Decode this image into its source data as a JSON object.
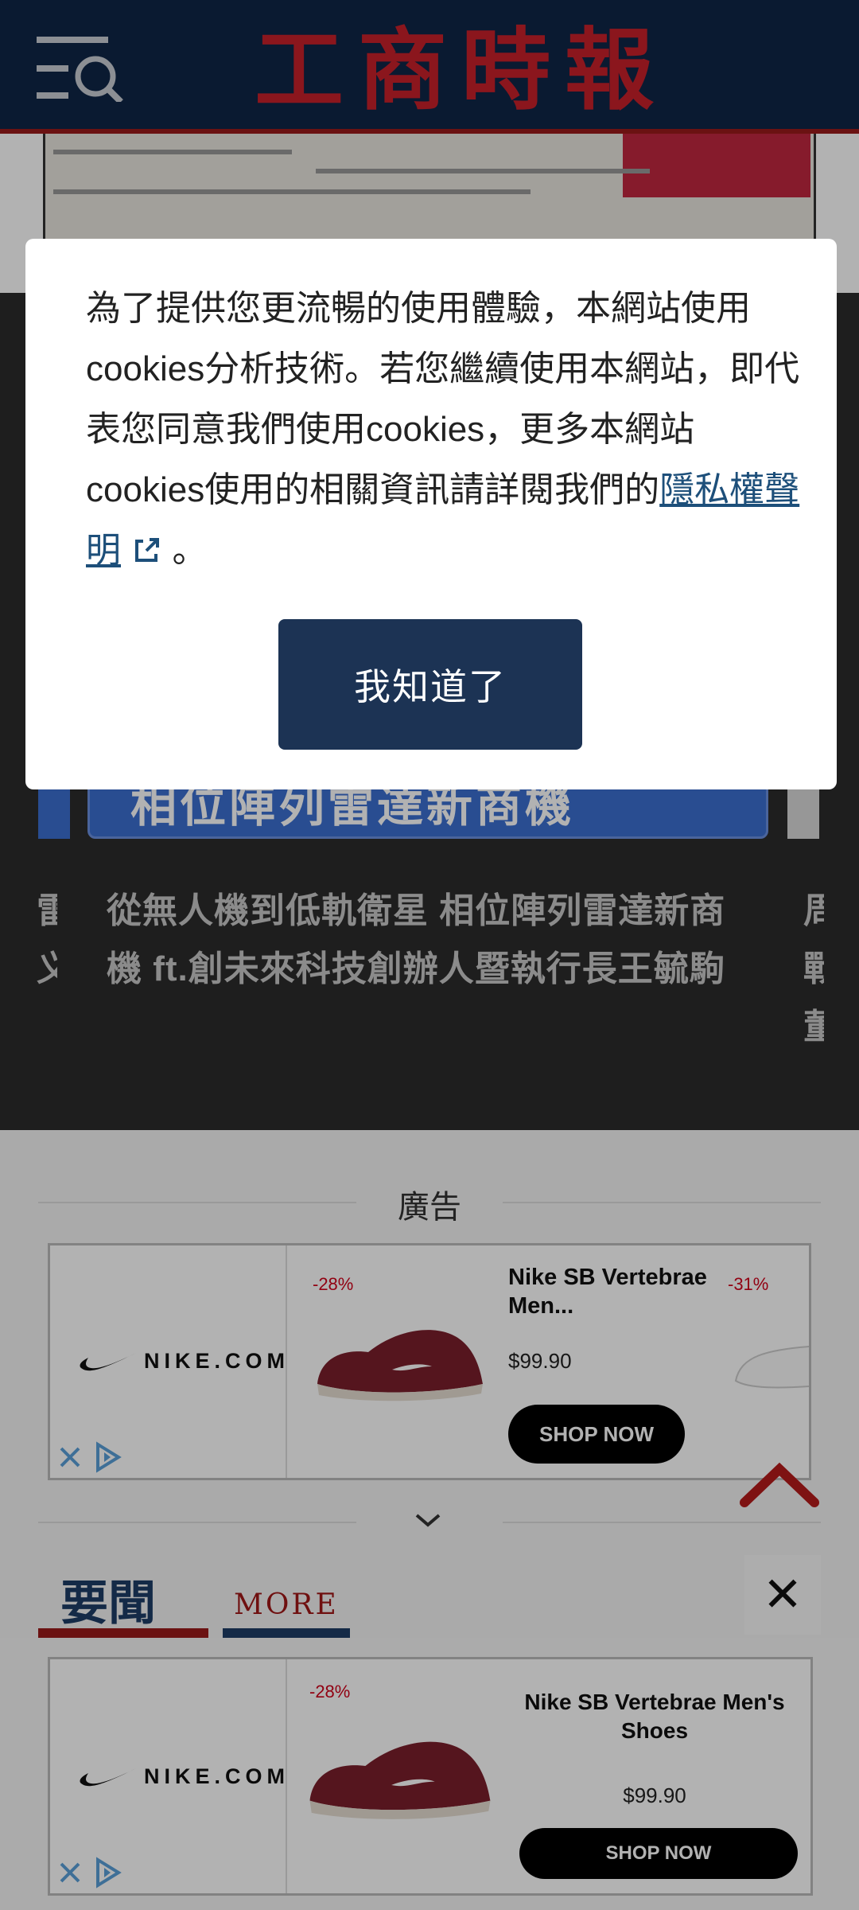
{
  "header": {
    "logo_text": "工商時報",
    "colors": {
      "bar": "#0f2647",
      "logo": "#c8202a",
      "accent_line": "#9a1a1a"
    }
  },
  "featured": {
    "thumbnail_text": "相位陣列雷達新商機",
    "title": "從無人機到低軌衛星 相位陣列雷達新商機 ft.創未來科技創辦人暨執行長王毓駒",
    "left_fragment": "雷\n义",
    "right_fragment": "周\n戰\n董"
  },
  "ad_inline": {
    "label": "廣告",
    "brand": "NIKE.COM",
    "product_discount": "-28%",
    "product_name": "Nike SB Vertebrae Men...",
    "product_price": "$99.90",
    "shop_label": "SHOP NOW",
    "next_discount": "-31%"
  },
  "news": {
    "heading": "要聞",
    "more": "MORE"
  },
  "ad_bottom": {
    "brand": "NIKE.COM",
    "discount": "-28%",
    "product_name": "Nike SB Vertebrae Men's Shoes",
    "price": "$99.90",
    "shop_label": "SHOP NOW",
    "close_label": "✕"
  },
  "cookie_modal": {
    "text_before": "為了提供您更流暢的使用體驗，本網站使用cookies分析技術。若您繼續使用本網站，即代表您同意我們使用cookies，更多本網站cookies使用的相關資訊請詳閱我們的",
    "link_text": "隱私權聲明",
    "text_after": " 。",
    "button_label": "我知道了"
  }
}
